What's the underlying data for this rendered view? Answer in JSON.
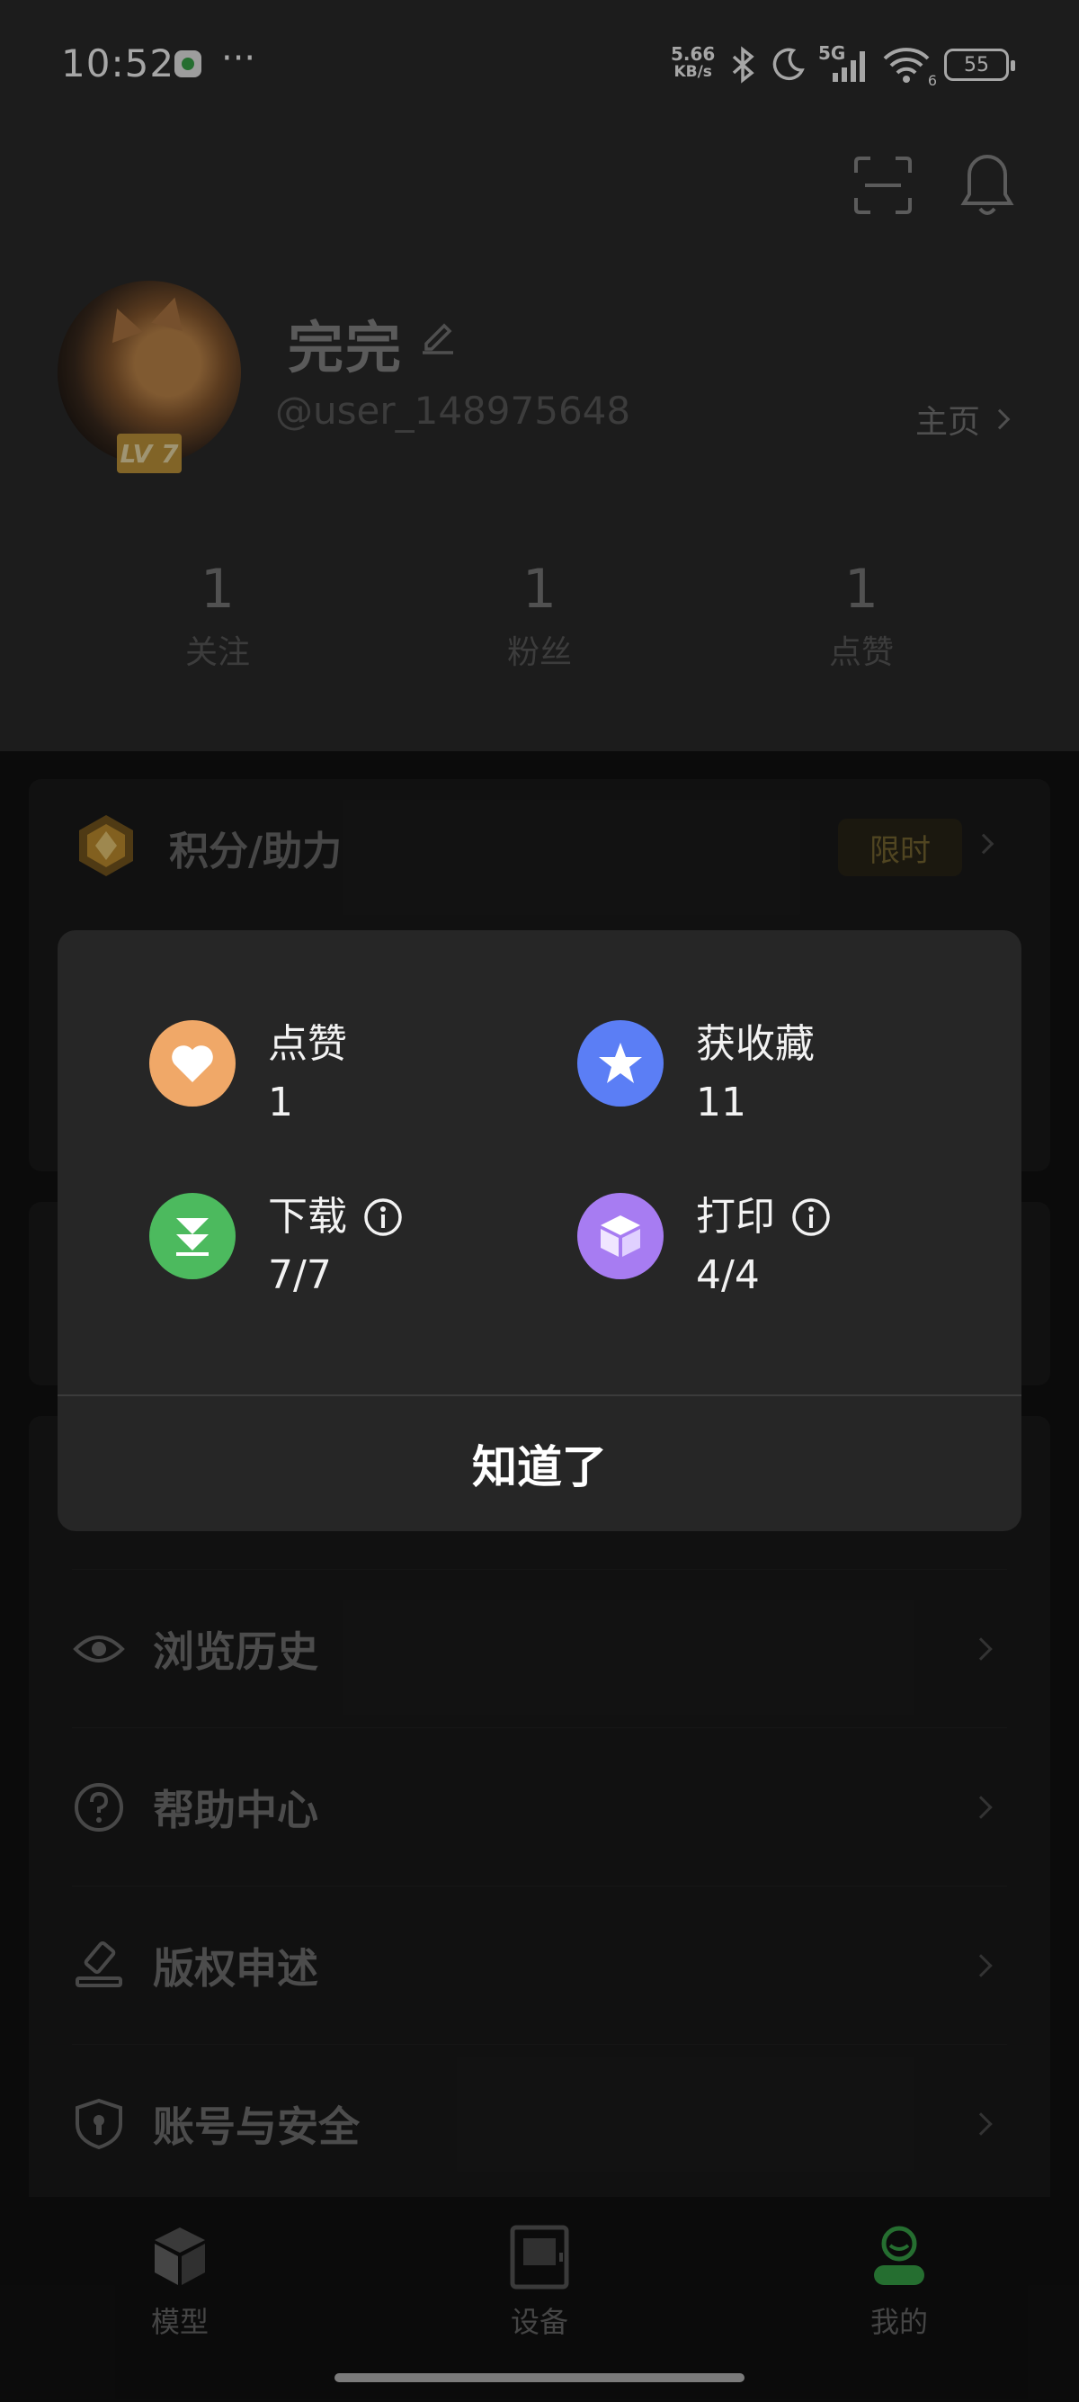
{
  "status_bar": {
    "time": "10:52",
    "more": "···",
    "net_speed_value": "5.66",
    "net_speed_unit": "KB/s",
    "network": "5G",
    "wifi_band": "6",
    "battery": "55"
  },
  "profile": {
    "username": "完完",
    "user_id": "@user_148975648",
    "level": "LV 7",
    "homepage_label": "主页"
  },
  "stats": [
    {
      "value": "1",
      "label": "关注"
    },
    {
      "value": "1",
      "label": "粉丝"
    },
    {
      "value": "1",
      "label": "点赞"
    }
  ],
  "points": {
    "title": "积分/助力",
    "badge": "限时"
  },
  "menu": [
    {
      "label": "浏览历史",
      "icon": "eye-icon"
    },
    {
      "label": "帮助中心",
      "icon": "help-icon"
    },
    {
      "label": "版权申述",
      "icon": "copyright-claim-icon"
    },
    {
      "label": "账号与安全",
      "icon": "shield-icon"
    }
  ],
  "tabs": [
    {
      "label": "模型",
      "icon": "model-icon",
      "active": false
    },
    {
      "label": "设备",
      "icon": "device-icon",
      "active": false
    },
    {
      "label": "我的",
      "icon": "me-icon",
      "active": true
    }
  ],
  "dialog": {
    "items": [
      {
        "label": "点赞",
        "value": "1",
        "icon": "heart-icon",
        "color": "#f0a868"
      },
      {
        "label": "获收藏",
        "value": "11",
        "icon": "star-icon",
        "color": "#5b7ef5"
      },
      {
        "label": "下载",
        "value": "7/7",
        "icon": "download-icon",
        "color": "#4cba5e"
      },
      {
        "label": "打印",
        "value": "4/4",
        "icon": "cube-icon",
        "color": "#a77cf2"
      }
    ],
    "confirm_label": "知道了"
  },
  "colors": {
    "accent_green": "#3aa94b",
    "header_bg": "#2b2b2b",
    "dialog_bg": "#262626"
  }
}
